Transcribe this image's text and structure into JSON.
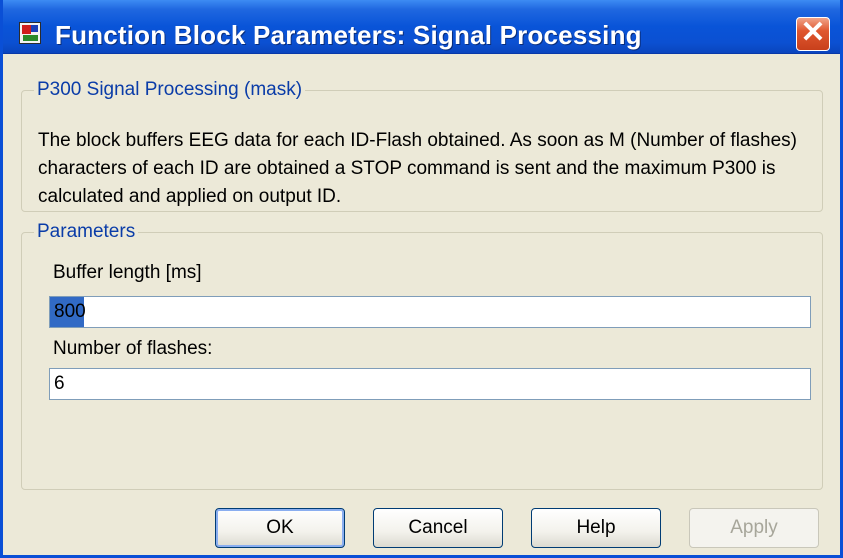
{
  "window": {
    "title": "Function Block Parameters: Signal Processing",
    "close_symbol": "✕",
    "app_icon": "simulink-block-icon"
  },
  "mask": {
    "legend": "P300 Signal Processing (mask)",
    "description": "The block buffers EEG data for each ID-Flash obtained. As soon as M (Number of flashes) characters of each ID are obtained a STOP command is sent and the maximum P300 is calculated and applied on output ID."
  },
  "parameters": {
    "legend": "Parameters",
    "buffer_length": {
      "label": "Buffer length [ms]",
      "value": "800"
    },
    "number_of_flashes": {
      "label": "Number of flashes:",
      "value": "6"
    }
  },
  "buttons": {
    "ok": "OK",
    "cancel": "Cancel",
    "help": "Help",
    "apply": "Apply"
  },
  "colors": {
    "titlebar": "#0954d8",
    "legend_text": "#0a3ca8",
    "selection": "#316ac5",
    "close_button": "#e0572f"
  }
}
